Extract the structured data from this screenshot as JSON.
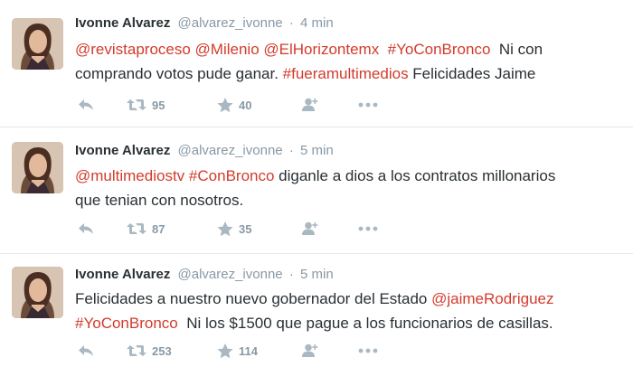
{
  "tweets": [
    {
      "fullname": "Ivonne Alvarez",
      "username": "@alvarez_ivonne",
      "separator": "·",
      "time": "4 min",
      "lines": [
        [
          {
            "t": "@revistaproceso",
            "k": "mention"
          },
          {
            "t": " ",
            "k": "plain"
          },
          {
            "t": "@Milenio",
            "k": "mention"
          },
          {
            "t": " ",
            "k": "plain"
          },
          {
            "t": "@ElHorizontemx",
            "k": "mention"
          },
          {
            "t": "  ",
            "k": "plain"
          },
          {
            "t": "#YoConBronco",
            "k": "hashtag"
          },
          {
            "t": "  Ni con",
            "k": "plain"
          }
        ],
        [
          {
            "t": "comprando votos pude ganar. ",
            "k": "plain"
          },
          {
            "t": "#fueramultimedios",
            "k": "hashtag"
          },
          {
            "t": " Felicidades Jaime",
            "k": "plain"
          }
        ]
      ],
      "retweets": "95",
      "favorites": "40"
    },
    {
      "fullname": "Ivonne Alvarez",
      "username": "@alvarez_ivonne",
      "separator": "·",
      "time": "5 min",
      "lines": [
        [
          {
            "t": "@multimediostv",
            "k": "mention"
          },
          {
            "t": " ",
            "k": "plain"
          },
          {
            "t": "#ConBronco",
            "k": "hashtag"
          },
          {
            "t": " diganle a dios a los contratos millonarios",
            "k": "plain"
          }
        ],
        [
          {
            "t": "que tenian con nosotros.",
            "k": "plain"
          }
        ]
      ],
      "retweets": "87",
      "favorites": "35"
    },
    {
      "fullname": "Ivonne Alvarez",
      "username": "@alvarez_ivonne",
      "separator": "·",
      "time": "5 min",
      "lines": [
        [
          {
            "t": "Felicidades a nuestro nuevo gobernador del Estado ",
            "k": "plain"
          },
          {
            "t": "@jaimeRodriguez",
            "k": "mention"
          }
        ],
        [
          {
            "t": "#YoConBronco",
            "k": "hashtag"
          },
          {
            "t": "  Ni los $1500 que pague a los funcionarios de casillas.",
            "k": "plain"
          }
        ]
      ],
      "retweets": "253",
      "favorites": "114"
    }
  ],
  "icons": {
    "reply": "reply-arrow-icon",
    "retweet": "retweet-icon",
    "favorite": "star-icon",
    "follow": "add-user-icon",
    "more": "ellipsis-icon"
  },
  "colors": {
    "link": "#d33b2c",
    "muted": "#8899a6",
    "icon": "#aab8c2",
    "text": "#292f33",
    "divider": "#e1e8ed"
  }
}
